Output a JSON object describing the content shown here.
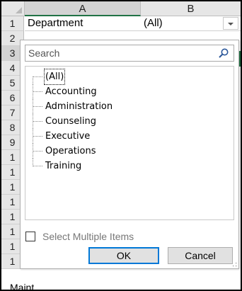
{
  "sheet": {
    "columns": [
      "A",
      "B"
    ],
    "rows": [
      "1",
      "2",
      "3",
      "4",
      "5",
      "6",
      "7",
      "8",
      "9",
      "1",
      "1",
      "1",
      "1",
      "1",
      "1",
      "1",
      "1"
    ],
    "cell_a1": "Department",
    "cell_b1": "(All)",
    "bottom_partial_text": "Maint",
    "accent_color": "#217346"
  },
  "filter_panel": {
    "search_placeholder": "Search",
    "items": [
      "(All)",
      "Accounting",
      "Administration",
      "Counseling",
      "Executive",
      "Operations",
      "Training"
    ],
    "select_multiple_label": "Select Multiple Items",
    "select_multiple_checked": false,
    "ok_label": "OK",
    "cancel_label": "Cancel"
  },
  "icons": {
    "search": "search-icon",
    "dropdown": "chevron-down-icon",
    "resize": "resize-grip-icon"
  }
}
